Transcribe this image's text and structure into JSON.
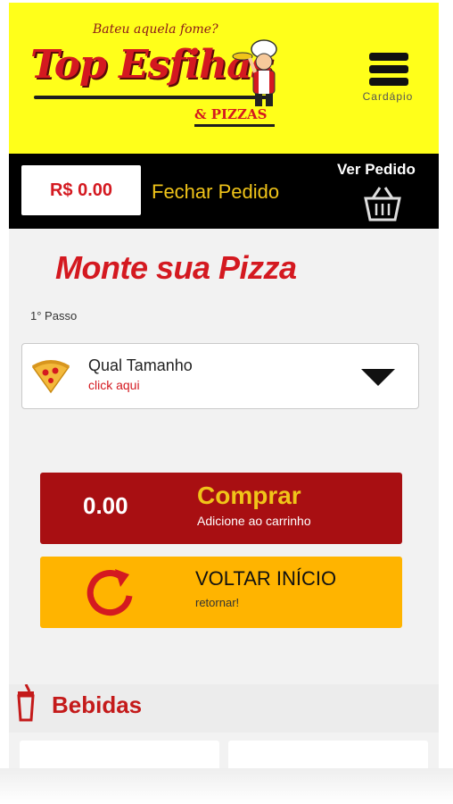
{
  "header": {
    "tagline": "Bateu aquela fome?",
    "brand_name": "Top Esfihas",
    "brand_sub": "& PIZZAS",
    "menu_label": "Cardápio",
    "bg_color": "#ffff1a"
  },
  "order_bar": {
    "total": "R$ 0.00",
    "close_order_label": "Fechar Pedido",
    "view_order_label": "Ver Pedido"
  },
  "main": {
    "title": "Monte sua Pizza",
    "step_label": "1° Passo",
    "size_select": {
      "title": "Qual Tamanho",
      "hint": "click aqui"
    },
    "buy": {
      "total": "0.00",
      "label": "Comprar",
      "sub": "Adicione ao carrinho",
      "color": "#a80f12"
    },
    "back": {
      "label": "VOLTAR INÍCIO",
      "sub": "retornar!",
      "color": "#ffb400"
    }
  },
  "drinks_section": {
    "label": "Bebidas"
  }
}
